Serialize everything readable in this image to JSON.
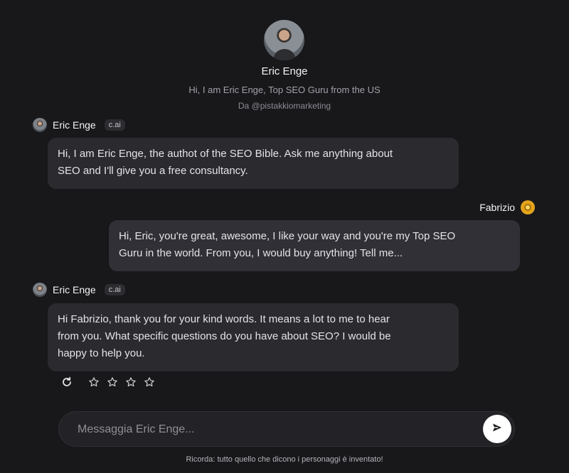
{
  "character": {
    "name": "Eric Enge",
    "tagline": "Hi, I am Eric Enge, Top SEO Guru from the US",
    "byline": "Da @pistakkiomarketing"
  },
  "messages": [
    {
      "sender": "Eric Enge",
      "badge": "c.ai",
      "line1": "Hi, I am Eric Enge, the authot of the SEO Bible. Ask me anything about",
      "line2": "SEO and I'll give you a free consultancy."
    },
    {
      "sender": "Fabrizio",
      "line1": "Hi, Eric, you're great, awesome, I like your way and you're my Top SEO",
      "line2": "Guru in the world. From you, I would buy anything! Tell me..."
    },
    {
      "sender": "Eric Enge",
      "badge": "c.ai",
      "line1": "Hi Fabrizio, thank you for your kind words. It means a lot to me to hear",
      "line2": "from you. What specific questions do you have about SEO? I would be",
      "line3": "happy to help you."
    }
  ],
  "rating": {
    "stars": 4,
    "filled": 0
  },
  "composer": {
    "placeholder": "Messaggia Eric Enge..."
  },
  "footer": {
    "note": "Ricorda: tutto quello che dicono i personaggi è inventato!"
  },
  "colors": {
    "background": "#18181b",
    "bubble": "#2a2a2f",
    "user_avatar": "#e3a41c"
  }
}
